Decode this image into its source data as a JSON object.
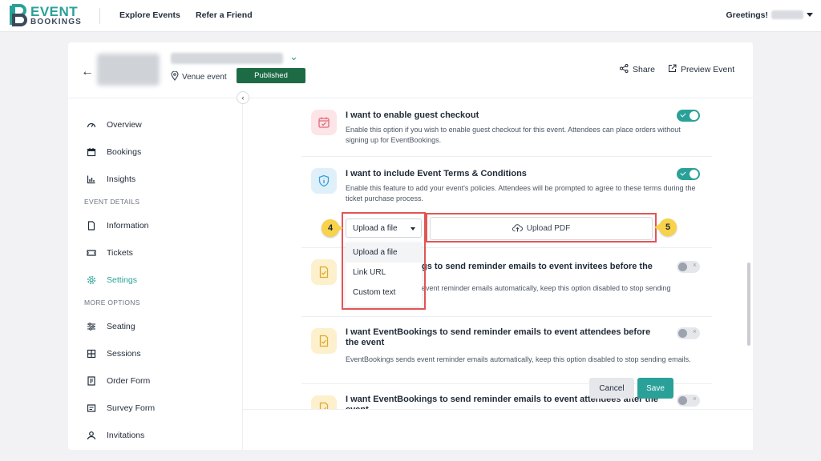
{
  "topnav": {
    "logo_line1": "EVENT",
    "logo_line2": "BOOKINGS",
    "links": [
      "Explore Events",
      "Refer a Friend"
    ],
    "greeting": "Greetings!"
  },
  "header": {
    "venue_label": "Venue event",
    "status": "Published",
    "share_label": "Share",
    "preview_label": "Preview Event"
  },
  "sidebar": {
    "items_top": [
      "Overview",
      "Bookings",
      "Insights"
    ],
    "section_event_details": "EVENT DETAILS",
    "items_event": [
      "Information",
      "Tickets",
      "Settings"
    ],
    "section_more": "MORE OPTIONS",
    "items_more": [
      "Seating",
      "Sessions",
      "Order Form",
      "Survey Form",
      "Invitations"
    ],
    "active": "Settings"
  },
  "settings": [
    {
      "title": "I want to enable guest checkout",
      "desc": "Enable this option if you wish to enable guest checkout for this event. Attendees can place orders without signing up for EventBookings.",
      "enabled": true
    },
    {
      "title": "I want to include Event Terms & Conditions",
      "desc": "Enable this feature to add your event's policies. Attendees will be prompted to agree to these terms during the ticket purchase process.",
      "enabled": true
    },
    {
      "title": "gs to send reminder emails to event invitees before the",
      "desc": "event reminder emails automatically, keep this option disabled to stop sending",
      "enabled": false
    },
    {
      "title": "I want EventBookings to send reminder emails to event attendees before the event",
      "desc": "EventBookings sends event reminder emails automatically, keep this option disabled to stop sending emails.",
      "enabled": false
    },
    {
      "title": "I want EventBookings to send reminder emails to event attendees after the event",
      "desc": "",
      "enabled": false
    }
  ],
  "terms_upload": {
    "select_value": "Upload a file",
    "options": [
      "Upload a file",
      "Link URL",
      "Custom text"
    ],
    "upload_pdf_label": "Upload PDF"
  },
  "annotations": {
    "badge_select": "4",
    "badge_pdf": "5",
    "highlight_color": "#e25555",
    "badge_color": "#f7d24a"
  },
  "footer": {
    "cancel_label": "Cancel",
    "save_label": "Save"
  },
  "colors": {
    "accent": "#2aa198",
    "published": "#1c6b45"
  }
}
